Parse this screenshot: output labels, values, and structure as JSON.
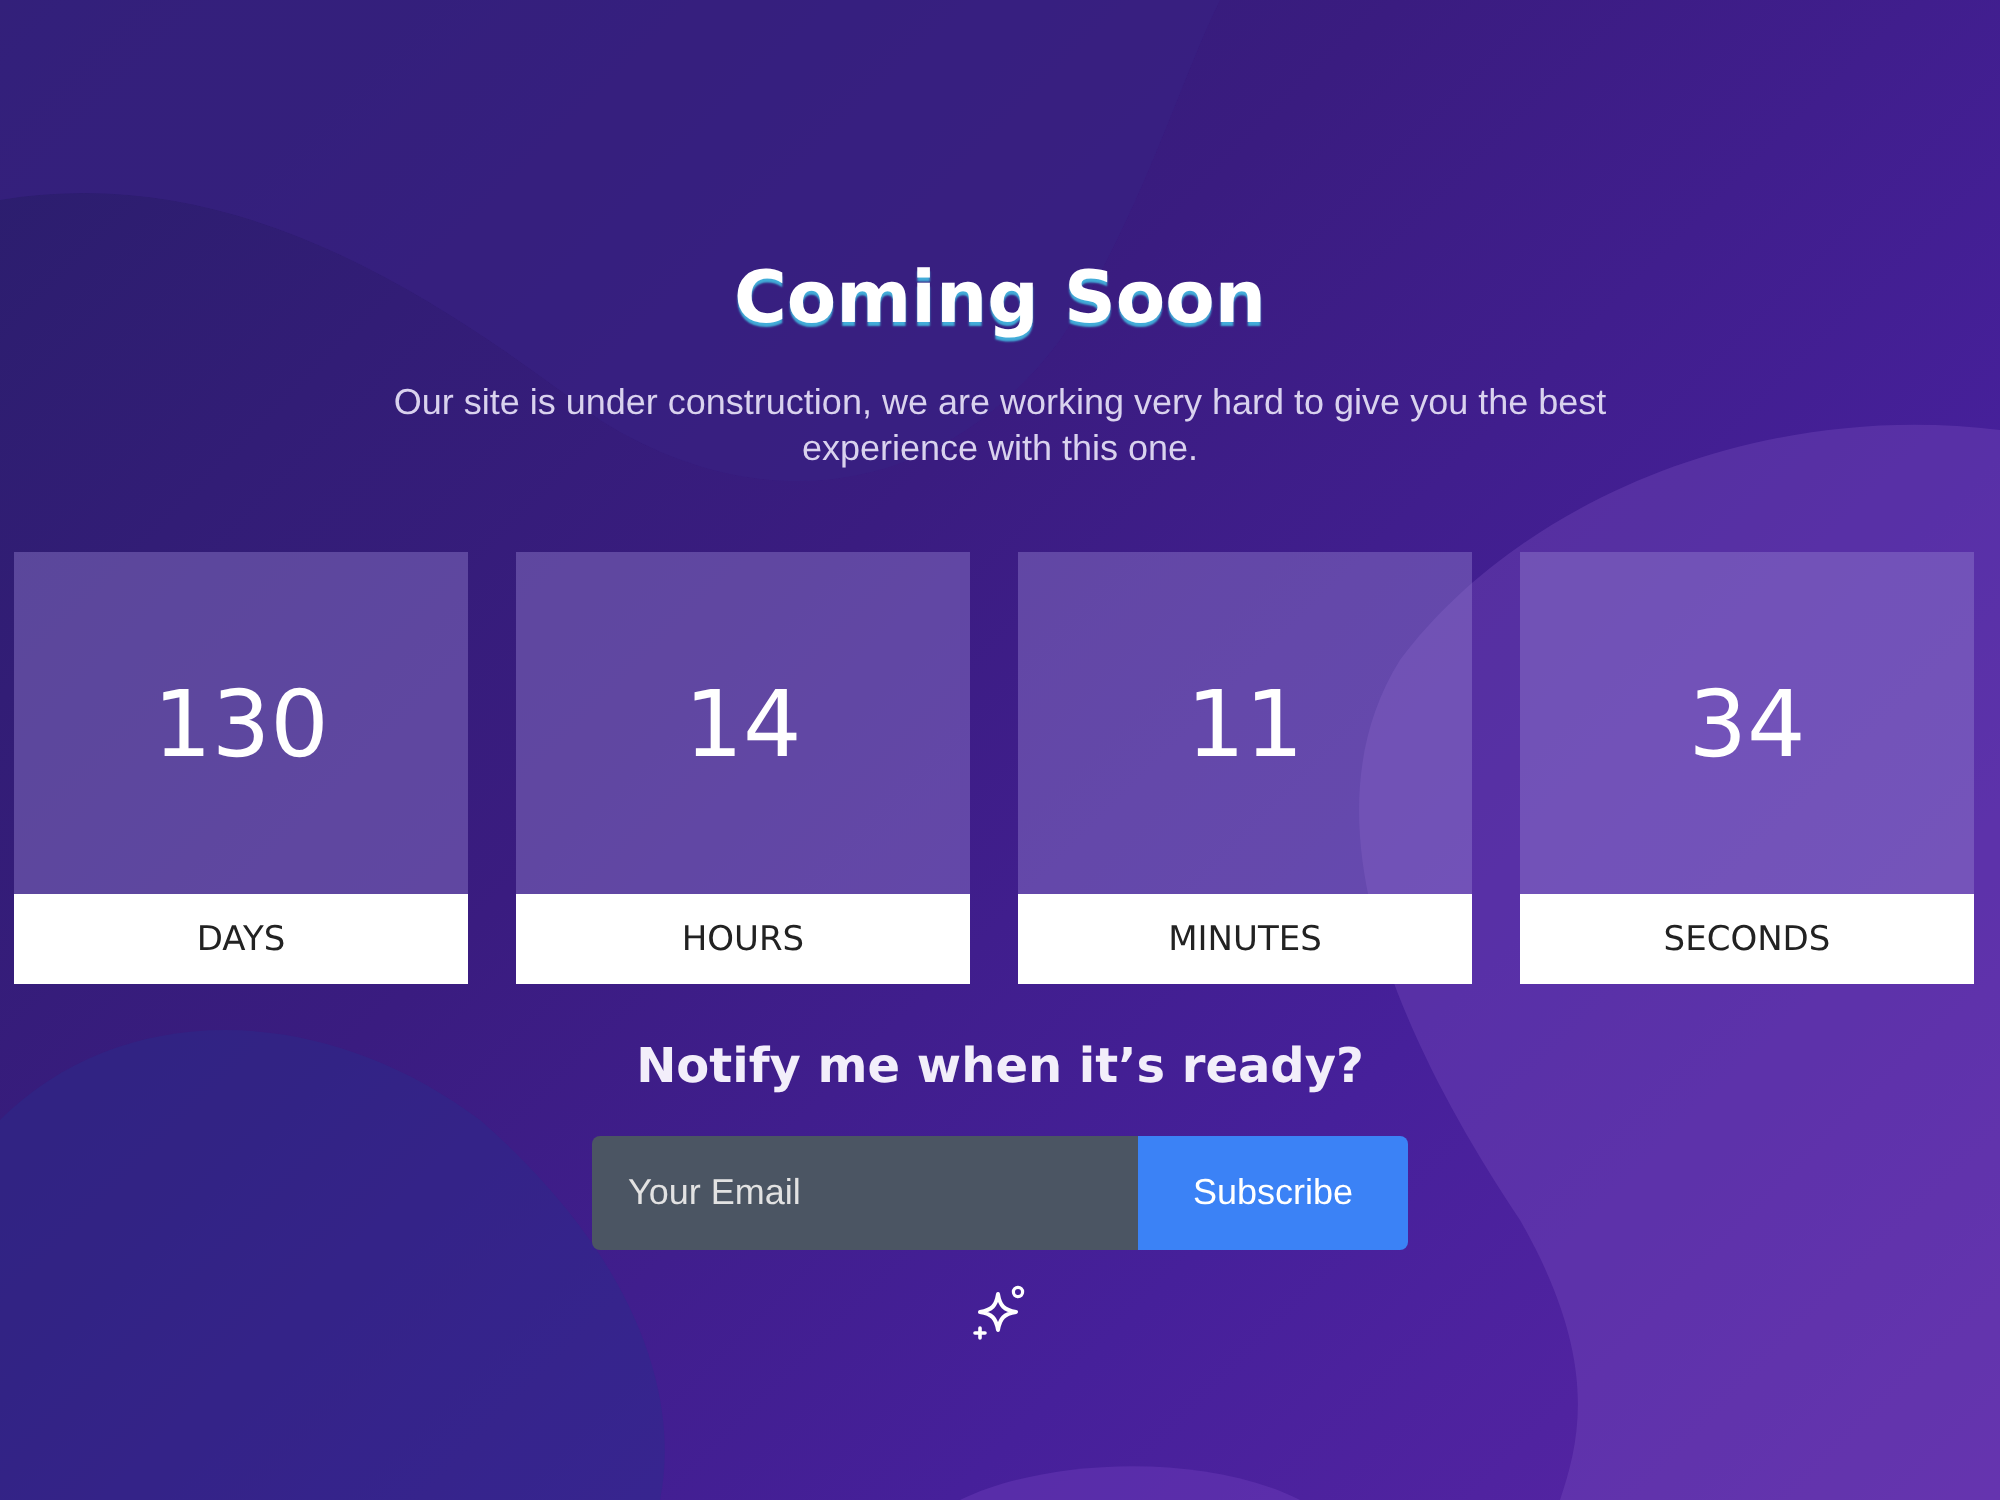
{
  "header": {
    "title": "Coming Soon",
    "subtitle": "Our site is under construction, we are working very hard to give you the best experience with this one."
  },
  "countdown": [
    {
      "value": "130",
      "unit": "DAYS"
    },
    {
      "value": "14",
      "unit": "HOURS"
    },
    {
      "value": "11",
      "unit": "MINUTES"
    },
    {
      "value": "34",
      "unit": "SECONDS"
    }
  ],
  "notify": {
    "heading": "Notify me when it’s ready?",
    "email_field": {
      "placeholder": "Your Email"
    },
    "button": "Subscribe"
  }
}
